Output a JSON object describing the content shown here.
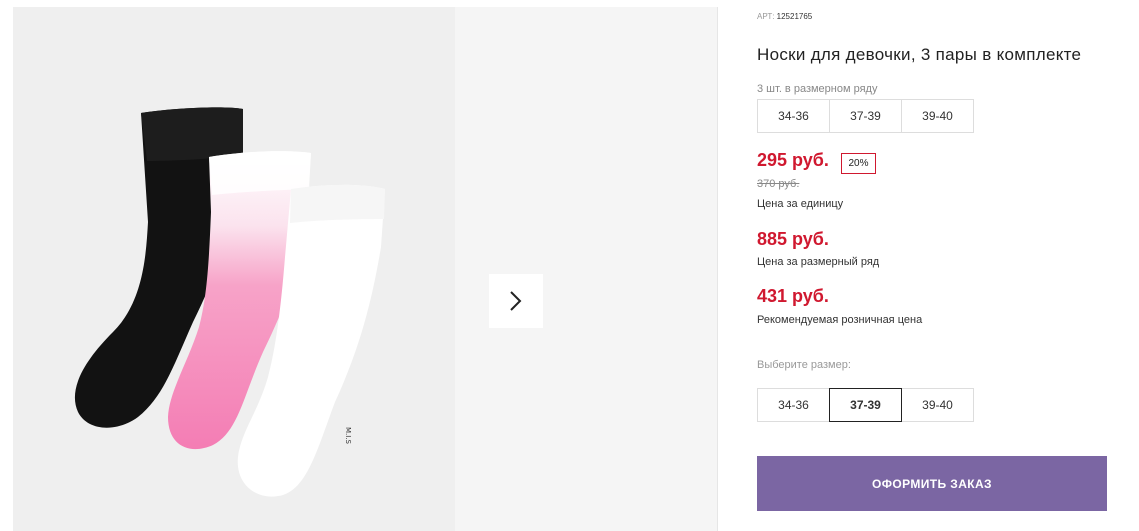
{
  "product": {
    "article_label": "АРТ:",
    "article_value": "12521765",
    "title": "Носки для девочки, 3 пары в комплекте",
    "row_caption": "3 шт. в размерном ряду",
    "row_sizes": [
      "34-36",
      "37-39",
      "39-40"
    ],
    "price_unit": "295 руб.",
    "discount": "20%",
    "old_price": "370 руб.",
    "price_unit_caption": "Цена за единицу",
    "price_row": "885 руб.",
    "price_row_caption": "Цена за размерный ряд",
    "price_retail": "431 руб.",
    "price_retail_caption": "Рекомендуемая розничная цена",
    "choose_label": "Выберите размер:",
    "choose_sizes": [
      "34-36",
      "37-39",
      "39-40"
    ],
    "selected_size": "37-39",
    "order_button": "ОФОРМИТЬ ЗАКАЗ"
  },
  "gallery": {
    "next_icon": "chevron-right-icon",
    "sock_label": "M.I.S"
  },
  "colors": {
    "price_red": "#d0182f",
    "button_purple": "#7b66a3"
  }
}
